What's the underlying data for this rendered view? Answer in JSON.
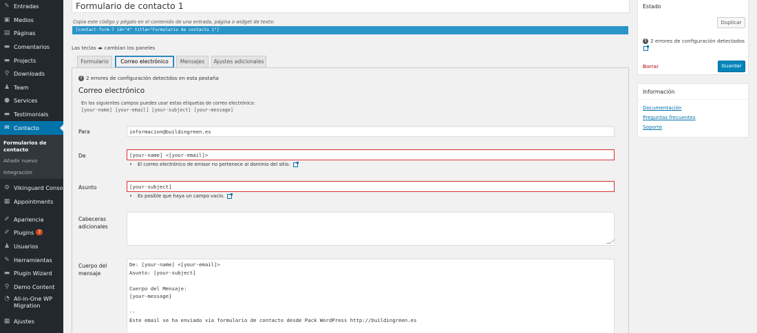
{
  "sidebar": {
    "items": [
      {
        "label": "Entradas",
        "icon": "pin-icon",
        "glyph": "✎"
      },
      {
        "label": "Medios",
        "icon": "media-icon",
        "glyph": "▣"
      },
      {
        "label": "Páginas",
        "icon": "pages-icon",
        "glyph": "▤"
      },
      {
        "label": "Comentarios",
        "icon": "comments-icon",
        "glyph": "▬"
      },
      {
        "label": "Projects",
        "icon": "projects-icon",
        "glyph": "▬"
      },
      {
        "label": "Downloads",
        "icon": "downloads-icon",
        "glyph": "⚲"
      },
      {
        "label": "Team",
        "icon": "team-icon",
        "glyph": "♟"
      },
      {
        "label": "Services",
        "icon": "services-icon",
        "glyph": "●"
      },
      {
        "label": "Testimonials",
        "icon": "testimonials-icon",
        "glyph": "▬"
      },
      {
        "label": "Contacto",
        "icon": "mail-icon",
        "glyph": "✉"
      },
      {
        "label": "Vikinguard Console",
        "icon": "gear-icon",
        "glyph": "⚙"
      },
      {
        "label": "Appointments",
        "icon": "calendar-icon",
        "glyph": "▦"
      },
      {
        "label": "Apariencia",
        "icon": "brush-icon",
        "glyph": "✐"
      },
      {
        "label": "Plugins",
        "icon": "plugins-icon",
        "glyph": "✐",
        "badge": "7"
      },
      {
        "label": "Usuarios",
        "icon": "users-icon",
        "glyph": "♟"
      },
      {
        "label": "Herramientas",
        "icon": "tools-icon",
        "glyph": "✎"
      },
      {
        "label": "Plugin Wizard",
        "icon": "wizard-icon",
        "glyph": "▬"
      },
      {
        "label": "Demo Content",
        "icon": "demo-icon",
        "glyph": "⚲"
      },
      {
        "label": "All-in-One WP Migration",
        "icon": "migration-icon",
        "glyph": "◔"
      },
      {
        "label": "Ajustes",
        "icon": "settings-icon",
        "glyph": "▦"
      }
    ],
    "submenu": [
      "Formularios de contacto",
      "Añadir nuevo",
      "Integración"
    ]
  },
  "form": {
    "title": "Formulario de contacto 1",
    "shortcode_hint": "Copia este código y pégalo en el contenido de una entrada, página o widget de texto:",
    "shortcode": "[contact-form-7 id=\"4\" title=\"Formulario de contacto 1\"]",
    "keys_hint": "Las teclas ◂▸ cambian los paneles"
  },
  "tabs": [
    "Formulario",
    "Correo electrónico",
    "Mensajes",
    "Ajustes adicionales"
  ],
  "panel": {
    "errors": "2 errores de configuración detectdos en esta pestaña",
    "heading": "Correo electrónico",
    "intro": "En los siguientes campos puedes usar estas etiquetas de correo electrónico:",
    "tags": "[your-name] [your-email] [your-subject] [your-message]",
    "para_label": "Para",
    "para_value": "informacion@buildingreen.es",
    "de_label": "De",
    "de_value": "[your-name] <[your-email]>",
    "de_note": "El correo electrónico de emisor no pertenece al dominio del sitio.",
    "asunto_label": "Asunto",
    "asunto_value": "[your-subject]",
    "asunto_note": "Es posible que haya un campo vacío.",
    "cabeceras_label": "Cabeceras adicionales",
    "cabeceras_value": "",
    "cuerpo_label": "Cuerpo del mensaje",
    "cuerpo_value": "De: [your-name] <[your-email]>\nAsunto: [your-subject]\n\nCuerpo del Mensaje:\n[your-message]\n\n--\nEste email se ha enviado vía formulario de contacto desde Pack WordPress http://buildingreen.es"
  },
  "status_box": {
    "title": "Estado",
    "duplicate": "Duplicar",
    "errors": "2 errores de configuración detectados",
    "delete": "Borrar",
    "save": "Guardar"
  },
  "info_box": {
    "title": "Información",
    "links": [
      "Documentación",
      "Preguntas frecuentes",
      "Soporte"
    ]
  },
  "colors": {
    "accent": "#0073aa",
    "error": "#dc3232",
    "sidebar": "#23282d"
  }
}
